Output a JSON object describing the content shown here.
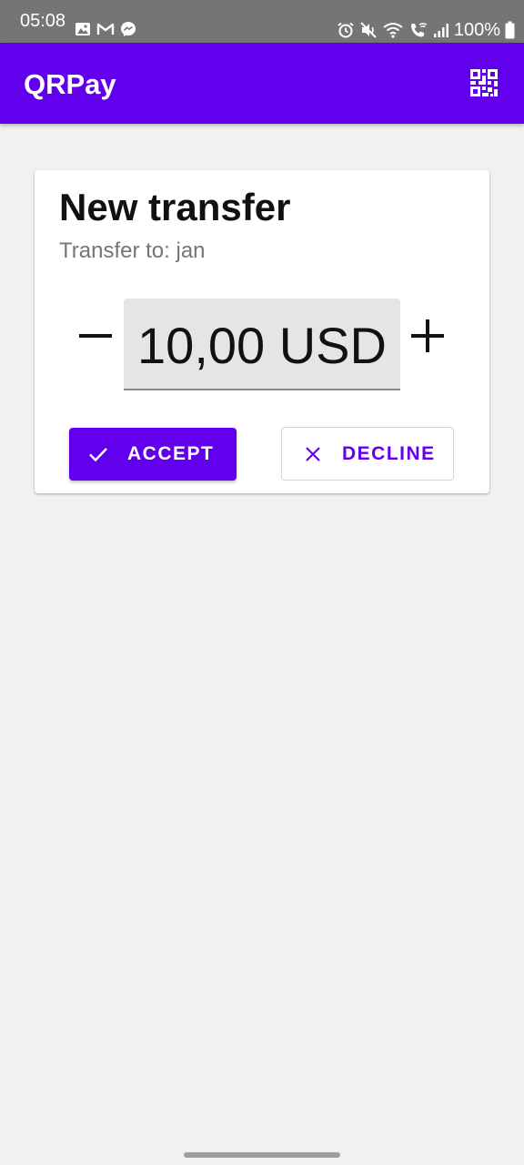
{
  "status_bar": {
    "time": "05:08",
    "left_icons": [
      "image-icon",
      "gmail-icon",
      "messenger-icon"
    ],
    "right_icons": [
      "alarm-icon",
      "mute-icon",
      "wifi-icon",
      "wifi-calling-icon",
      "signal-icon",
      "battery-icon"
    ],
    "battery_percent": "100%"
  },
  "app_bar": {
    "title": "QRPay",
    "action_icon": "qr-code-icon"
  },
  "transfer_card": {
    "title": "New transfer",
    "subtitle": "Transfer to: jan",
    "amount": "10,00 USD",
    "decrement_symbol": "minus-icon",
    "increment_symbol": "plus-icon",
    "accept_label": "ACCEPT",
    "accept_icon": "check-icon",
    "decline_label": "DECLINE",
    "decline_icon": "close-icon"
  },
  "colors": {
    "primary": "#6200ee",
    "status_bar": "#757575",
    "background": "#f1f1f1",
    "amount_field": "#e5e5e5"
  }
}
